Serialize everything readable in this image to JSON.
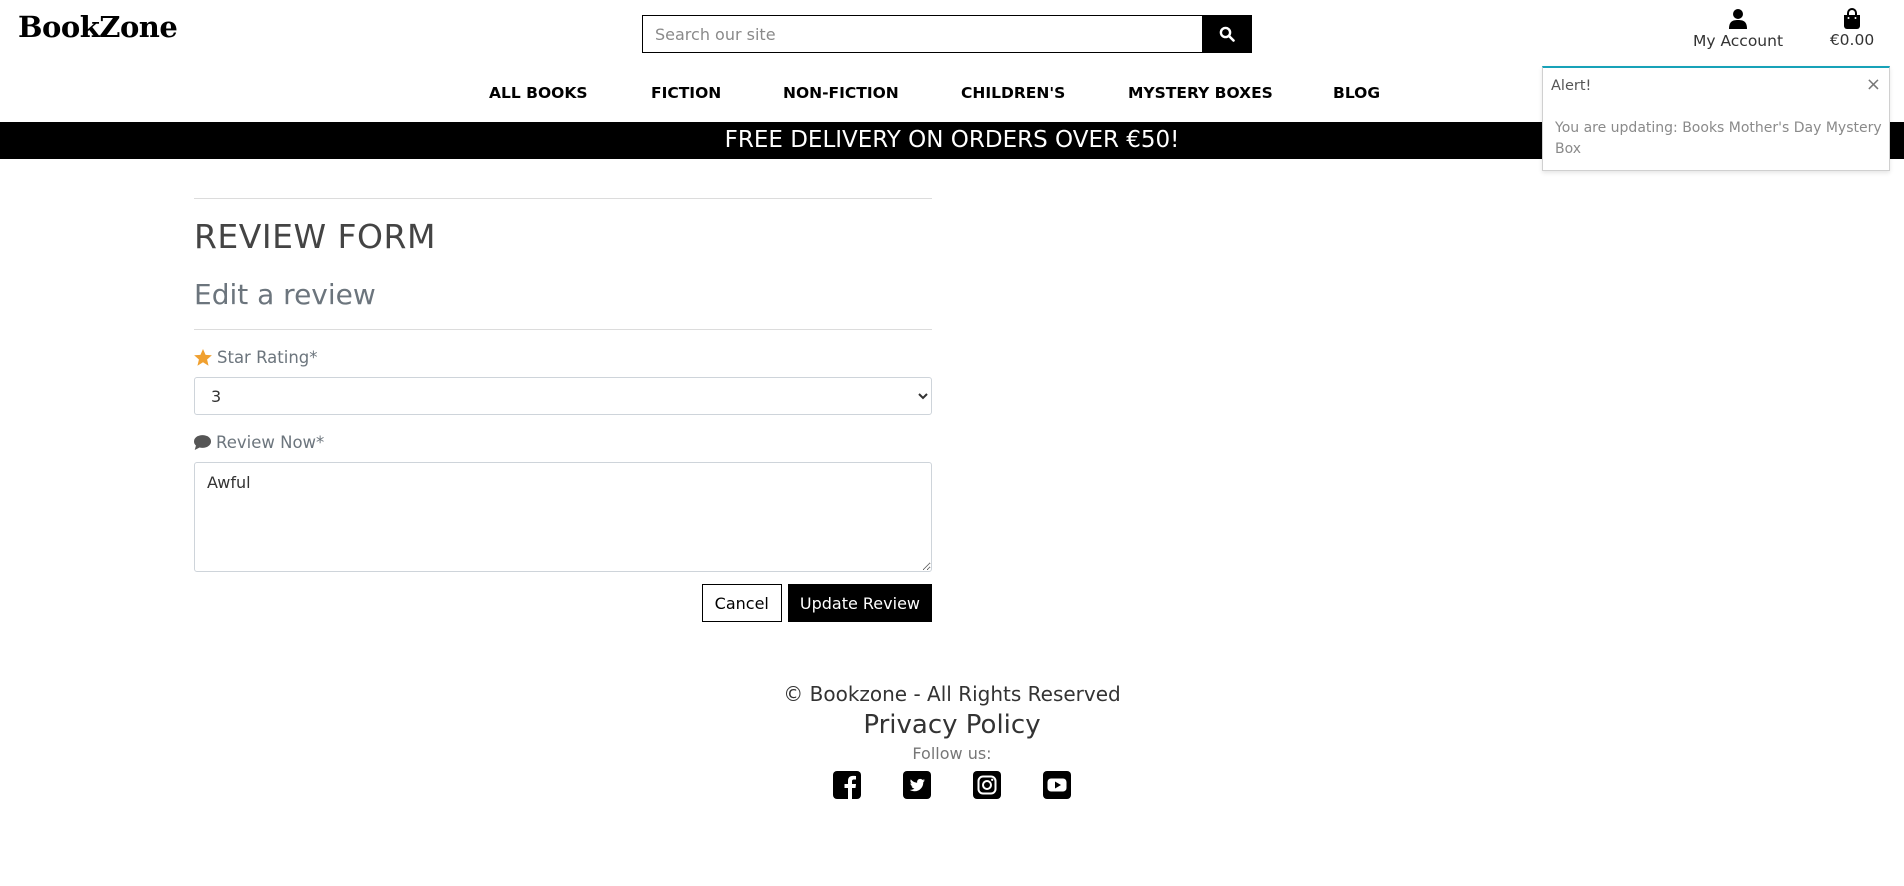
{
  "header": {
    "logo": "BookZone",
    "search_placeholder": "Search our site",
    "account_label": "My Account",
    "cart_total": "€0.00"
  },
  "nav": {
    "items": [
      "ALL BOOKS",
      "FICTION",
      "NON-FICTION",
      "CHILDREN'S",
      "MYSTERY BOXES",
      "BLOG"
    ]
  },
  "banner": {
    "text": "FREE DELIVERY ON ORDERS OVER €50!"
  },
  "toast": {
    "title": "Alert!",
    "close": "×",
    "message": "You are updating: Books Mother's Day Mystery Box"
  },
  "form": {
    "heading": "REVIEW FORM",
    "subheading": "Edit a review",
    "rating_label": "Star Rating*",
    "rating_value": "3",
    "review_label": "Review Now*",
    "review_value": "Awful",
    "cancel_label": "Cancel",
    "update_label": "Update Review"
  },
  "footer": {
    "copyright": "© Bookzone - All Rights Reserved",
    "privacy": "Privacy Policy",
    "follow": "Follow us:",
    "social_icons": [
      "facebook-icon",
      "twitter-icon",
      "instagram-icon",
      "youtube-icon"
    ]
  },
  "colors": {
    "star": "#f0a030",
    "toast_accent": "#17a2b8",
    "banner_bg": "#000000"
  }
}
